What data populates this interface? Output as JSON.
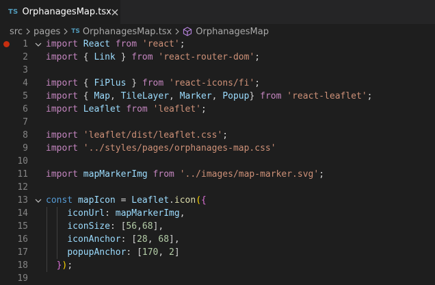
{
  "tab": {
    "lang_badge": "TS",
    "title": "OrphanagesMap.tsx"
  },
  "breadcrumb": {
    "items": [
      "src",
      "pages",
      "OrphanagesMap.tsx",
      "OrphanagesMap"
    ],
    "file_badge": "TS"
  },
  "editor": {
    "breakpoint_line": 1,
    "fold_lines": [
      1,
      13
    ],
    "lines": [
      {
        "n": "1",
        "tokens": [
          [
            "k",
            "import"
          ],
          [
            "p",
            " "
          ],
          [
            "v",
            "React"
          ],
          [
            "p",
            " "
          ],
          [
            "k",
            "from"
          ],
          [
            "p",
            " "
          ],
          [
            "s",
            "'react'"
          ],
          [
            "p",
            ";"
          ]
        ]
      },
      {
        "n": "2",
        "tokens": [
          [
            "k",
            "import"
          ],
          [
            "p",
            " { "
          ],
          [
            "v",
            "Link"
          ],
          [
            "p",
            " } "
          ],
          [
            "k",
            "from"
          ],
          [
            "p",
            " "
          ],
          [
            "s",
            "'react-router-dom'"
          ],
          [
            "p",
            ";"
          ]
        ]
      },
      {
        "n": "3",
        "tokens": []
      },
      {
        "n": "4",
        "tokens": [
          [
            "k",
            "import"
          ],
          [
            "p",
            " { "
          ],
          [
            "v",
            "FiPlus"
          ],
          [
            "p",
            " } "
          ],
          [
            "k",
            "from"
          ],
          [
            "p",
            " "
          ],
          [
            "s",
            "'react-icons/fi'"
          ],
          [
            "p",
            ";"
          ]
        ]
      },
      {
        "n": "5",
        "tokens": [
          [
            "k",
            "import"
          ],
          [
            "p",
            " { "
          ],
          [
            "v",
            "Map"
          ],
          [
            "p",
            ", "
          ],
          [
            "v",
            "TileLayer"
          ],
          [
            "p",
            ", "
          ],
          [
            "v",
            "Marker"
          ],
          [
            "p",
            ", "
          ],
          [
            "v",
            "Popup"
          ],
          [
            "p",
            "} "
          ],
          [
            "k",
            "from"
          ],
          [
            "p",
            " "
          ],
          [
            "s",
            "'react-leaflet'"
          ],
          [
            "p",
            ";"
          ]
        ]
      },
      {
        "n": "6",
        "tokens": [
          [
            "k",
            "import"
          ],
          [
            "p",
            " "
          ],
          [
            "v",
            "Leaflet"
          ],
          [
            "p",
            " "
          ],
          [
            "k",
            "from"
          ],
          [
            "p",
            " "
          ],
          [
            "s",
            "'leaflet'"
          ],
          [
            "p",
            ";"
          ]
        ]
      },
      {
        "n": "7",
        "tokens": []
      },
      {
        "n": "8",
        "tokens": [
          [
            "k",
            "import"
          ],
          [
            "p",
            " "
          ],
          [
            "s",
            "'leaflet/dist/leaflet.css'"
          ],
          [
            "p",
            ";"
          ]
        ]
      },
      {
        "n": "9",
        "tokens": [
          [
            "k",
            "import"
          ],
          [
            "p",
            " "
          ],
          [
            "s",
            "'../styles/pages/orphanages-map.css'"
          ]
        ]
      },
      {
        "n": "10",
        "tokens": []
      },
      {
        "n": "11",
        "tokens": [
          [
            "k",
            "import"
          ],
          [
            "p",
            " "
          ],
          [
            "v",
            "mapMarkerImg"
          ],
          [
            "p",
            " "
          ],
          [
            "k",
            "from"
          ],
          [
            "p",
            " "
          ],
          [
            "s",
            "'../images/map-marker.svg'"
          ],
          [
            "p",
            ";"
          ]
        ]
      },
      {
        "n": "12",
        "tokens": []
      },
      {
        "n": "13",
        "tokens": [
          [
            "b",
            "const"
          ],
          [
            "p",
            " "
          ],
          [
            "v",
            "mapIcon"
          ],
          [
            "p",
            " = "
          ],
          [
            "v",
            "Leaflet"
          ],
          [
            "p",
            "."
          ],
          [
            "f",
            "icon"
          ],
          [
            "g",
            "("
          ],
          [
            "g2",
            "{"
          ]
        ]
      },
      {
        "n": "14",
        "tokens": [
          [
            "p",
            "    "
          ],
          [
            "v",
            "iconUrl"
          ],
          [
            "p",
            ": "
          ],
          [
            "v",
            "mapMarkerImg"
          ],
          [
            "p",
            ","
          ]
        ]
      },
      {
        "n": "15",
        "tokens": [
          [
            "p",
            "    "
          ],
          [
            "v",
            "iconSize"
          ],
          [
            "p",
            ": "
          ],
          [
            "p",
            "["
          ],
          [
            "n",
            "56"
          ],
          [
            "p",
            ","
          ],
          [
            "n",
            "68"
          ],
          [
            "p",
            "],"
          ]
        ]
      },
      {
        "n": "16",
        "tokens": [
          [
            "p",
            "    "
          ],
          [
            "v",
            "iconAnchor"
          ],
          [
            "p",
            ": "
          ],
          [
            "p",
            "["
          ],
          [
            "n",
            "28"
          ],
          [
            "p",
            ", "
          ],
          [
            "n",
            "68"
          ],
          [
            "p",
            "],"
          ]
        ]
      },
      {
        "n": "17",
        "tokens": [
          [
            "p",
            "    "
          ],
          [
            "v",
            "popupAnchor"
          ],
          [
            "p",
            ": "
          ],
          [
            "p",
            "["
          ],
          [
            "n",
            "170"
          ],
          [
            "p",
            ", "
          ],
          [
            "n",
            "2"
          ],
          [
            "p",
            "]"
          ]
        ]
      },
      {
        "n": "18",
        "tokens": [
          [
            "p",
            "  "
          ],
          [
            "g2",
            "}"
          ],
          [
            "g",
            ")"
          ],
          [
            "p",
            ";"
          ]
        ]
      },
      {
        "n": "19",
        "tokens": []
      }
    ]
  }
}
